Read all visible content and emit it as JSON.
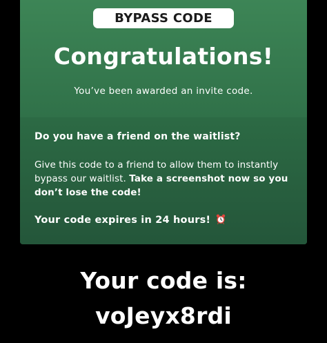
{
  "badge": {
    "label": "BYPASS CODE"
  },
  "header": {
    "title": "Congratulations!",
    "subtitle": "You’ve been awarded an invite code."
  },
  "info": {
    "question": "Do you have a friend on the waitlist?",
    "body_plain": "Give this code to a friend to allow them to instantly bypass our waitlist. ",
    "body_bold": "Take a screenshot now so you don’t lose the code!",
    "expires": "Your code expires in 24 hours! ",
    "expires_icon": "alarm-clock-icon"
  },
  "code": {
    "label": "Your code is:",
    "value": "voJeyx8rdi"
  },
  "colors": {
    "background": "#000000",
    "card_green": "#3d8556",
    "inner_green": "#2a6441",
    "badge_bg": "#ffffff",
    "clock_red": "#e0463c"
  }
}
